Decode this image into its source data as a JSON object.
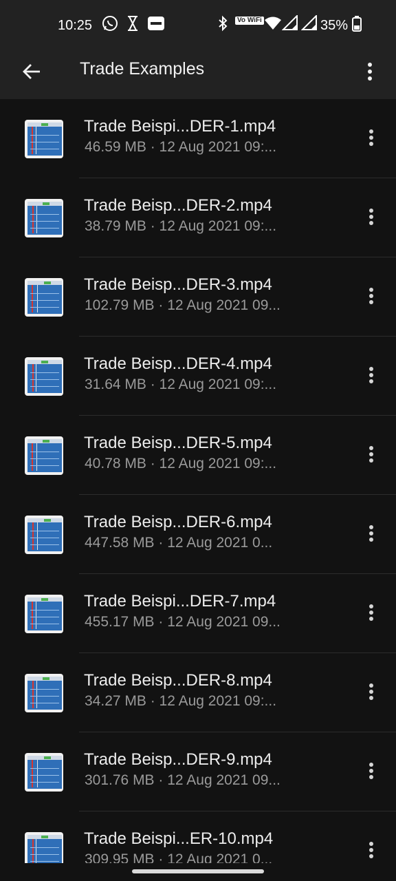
{
  "status_bar": {
    "time": "10:25",
    "network_label": "Vo WiFi",
    "battery": "35%",
    "icons": [
      "whatsapp-icon",
      "hourglass-icon",
      "paytm-icon",
      "bluetooth-icon",
      "volte-wifi-icon",
      "wifi-icon",
      "signal-icon",
      "signal-icon",
      "battery-icon"
    ]
  },
  "appbar": {
    "title": "Trade Examples",
    "back_icon": "arrow-left-icon",
    "overflow_icon": "more-vert-icon"
  },
  "files": [
    {
      "name": "Trade Beispi...DER-1.mp4",
      "meta": "46.59 MB · 12 Aug 2021 09:..."
    },
    {
      "name": "Trade Beisp...DER-2.mp4",
      "meta": "38.79 MB · 12 Aug 2021 09:..."
    },
    {
      "name": "Trade Beisp...DER-3.mp4",
      "meta": "102.79 MB · 12 Aug 2021 09..."
    },
    {
      "name": "Trade Beisp...DER-4.mp4",
      "meta": "31.64 MB · 12 Aug 2021 09:..."
    },
    {
      "name": "Trade Beisp...DER-5.mp4",
      "meta": "40.78 MB · 12 Aug 2021 09:..."
    },
    {
      "name": "Trade Beisp...DER-6.mp4",
      "meta": "447.58 MB · 12 Aug 2021 0..."
    },
    {
      "name": "Trade Beispi...DER-7.mp4",
      "meta": "455.17 MB · 12 Aug 2021 09..."
    },
    {
      "name": "Trade Beisp...DER-8.mp4",
      "meta": "34.27 MB · 12 Aug 2021 09:..."
    },
    {
      "name": "Trade Beisp...DER-9.mp4",
      "meta": "301.76 MB · 12 Aug 2021 09..."
    },
    {
      "name": "Trade Beispi...ER-10.mp4",
      "meta": "309.95 MB · 12 Aug 2021 0..."
    }
  ],
  "colors": {
    "background": "#121212",
    "bar": "#222222",
    "text_primary": "#ececec",
    "text_secondary": "#9a9a9a",
    "thumb_blue": "#2f6fb8",
    "thumb_red": "#d6362f"
  }
}
